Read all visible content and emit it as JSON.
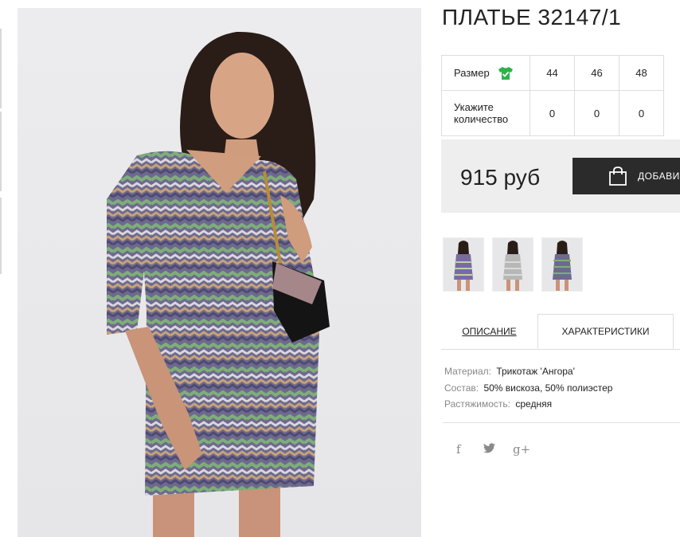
{
  "product": {
    "title": "ПЛАТЬЕ 32147/1",
    "image_alt": "main-product-photo"
  },
  "size_table": {
    "size_label": "Размер",
    "quantity_label": "Укажите количество",
    "sizes": [
      "44",
      "46",
      "48"
    ],
    "quantities": [
      "0",
      "0",
      "0"
    ],
    "size_icon": "shirt-check-icon",
    "size_icon_color": "#2db34a"
  },
  "purchase": {
    "price": "915 руб",
    "add_button_label": "ДОБАВИТ",
    "add_icon": "shopping-bag-icon"
  },
  "thumbnails": [
    {
      "name": "thumb-purple-dress"
    },
    {
      "name": "thumb-grey-dress"
    },
    {
      "name": "thumb-multicolor-dress"
    }
  ],
  "tabs": {
    "description": "ОПИСАНИЕ",
    "characteristics": "ХАРАКТЕРИСТИКИ",
    "active": "characteristics"
  },
  "properties": [
    {
      "key": "Материал:",
      "value": "Трикотаж 'Ангора'"
    },
    {
      "key": "Состав:",
      "value": "50% вискоза, 50% полиэстер"
    },
    {
      "key": "Растяжимость:",
      "value": "средняя"
    }
  ],
  "social": {
    "facebook": "f",
    "twitter": "ᴛ",
    "google_plus": "g+"
  },
  "colors": {
    "dark_button": "#2b2b2b",
    "price_bg": "#eeeeee",
    "accent_green": "#2db34a"
  }
}
